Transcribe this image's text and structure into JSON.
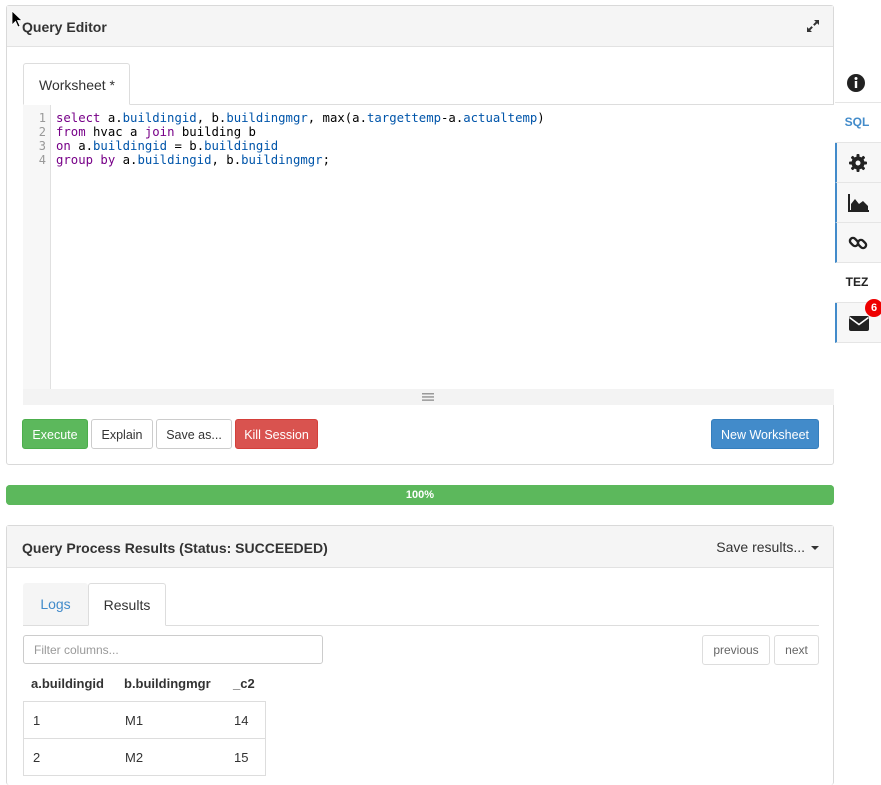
{
  "query_editor": {
    "title": "Query Editor",
    "tab_label": "Worksheet *",
    "line_numbers": [
      "1",
      "2",
      "3",
      "4"
    ],
    "sql": {
      "l1_kw1": "select",
      "l1_a": " a.",
      "l1_p1": "buildingid",
      "l1_b": ", b.",
      "l1_p2": "buildingmgr",
      "l1_c": ", max(a.",
      "l1_p3": "targettemp",
      "l1_d": "-a.",
      "l1_p4": "actualtemp",
      "l1_e": ")",
      "l2_kw1": "from",
      "l2_a": " hvac a ",
      "l2_kw2": "join",
      "l2_b": " building b",
      "l3_kw1": "on",
      "l3_a": " a.",
      "l3_p1": "buildingid",
      "l3_b": " = b.",
      "l3_p2": "buildingid",
      "l4_kw1": "group by",
      "l4_a": " a.",
      "l4_p1": "buildingid",
      "l4_b": ", b.",
      "l4_p2": "buildingmgr",
      "l4_c": ";"
    },
    "buttons": {
      "execute": "Execute",
      "explain": "Explain",
      "save_as": "Save as...",
      "kill_session": "Kill Session",
      "new_worksheet": "New Worksheet"
    }
  },
  "sidebar": {
    "items": [
      {
        "icon": "info-icon"
      },
      {
        "label": "SQL"
      },
      {
        "icon": "gear-icon"
      },
      {
        "icon": "area-chart-icon"
      },
      {
        "icon": "link-icon"
      },
      {
        "label": "TEZ"
      },
      {
        "icon": "envelope-icon",
        "badge": "6"
      }
    ]
  },
  "progress": {
    "label": "100%",
    "fraction": 1.0
  },
  "results": {
    "title": "Query Process Results (Status: SUCCEEDED)",
    "save_results_label": "Save results...",
    "tabs": [
      "Logs",
      "Results"
    ],
    "filter_placeholder": "Filter columns...",
    "pager": {
      "previous": "previous",
      "next": "next"
    },
    "columns": [
      "a.buildingid",
      "b.buildingmgr",
      "_c2"
    ],
    "rows": [
      [
        "1",
        "M1",
        "14"
      ],
      [
        "2",
        "M2",
        "15"
      ]
    ]
  },
  "colors": {
    "success": "#5cb85c",
    "danger": "#d9534f",
    "primary": "#428bca",
    "sql_keyword": "#770088",
    "sql_property": "#0055aa"
  }
}
